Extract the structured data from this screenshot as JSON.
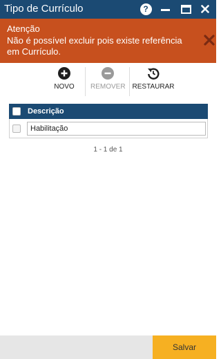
{
  "window": {
    "title": "Tipo de Currículo",
    "help_glyph": "?",
    "accent": "#1b4a73"
  },
  "alert": {
    "heading": "Atenção",
    "message": "Não é possível excluir pois existe referência em Currículo.",
    "color": "#c7501e"
  },
  "toolbar": {
    "novo": "NOVO",
    "remover": "REMOVER",
    "restaurar": "RESTAURAR",
    "icons": [
      "plus-circle-icon",
      "minus-circle-icon",
      "undo-icon"
    ]
  },
  "grid": {
    "columns": [
      "Descrição"
    ],
    "rows": [
      {
        "descricao": "Habilitação"
      }
    ]
  },
  "pager": {
    "text": "1 - 1 de 1"
  },
  "footer": {
    "save_label": "Salvar",
    "save_color": "#f6b022"
  }
}
